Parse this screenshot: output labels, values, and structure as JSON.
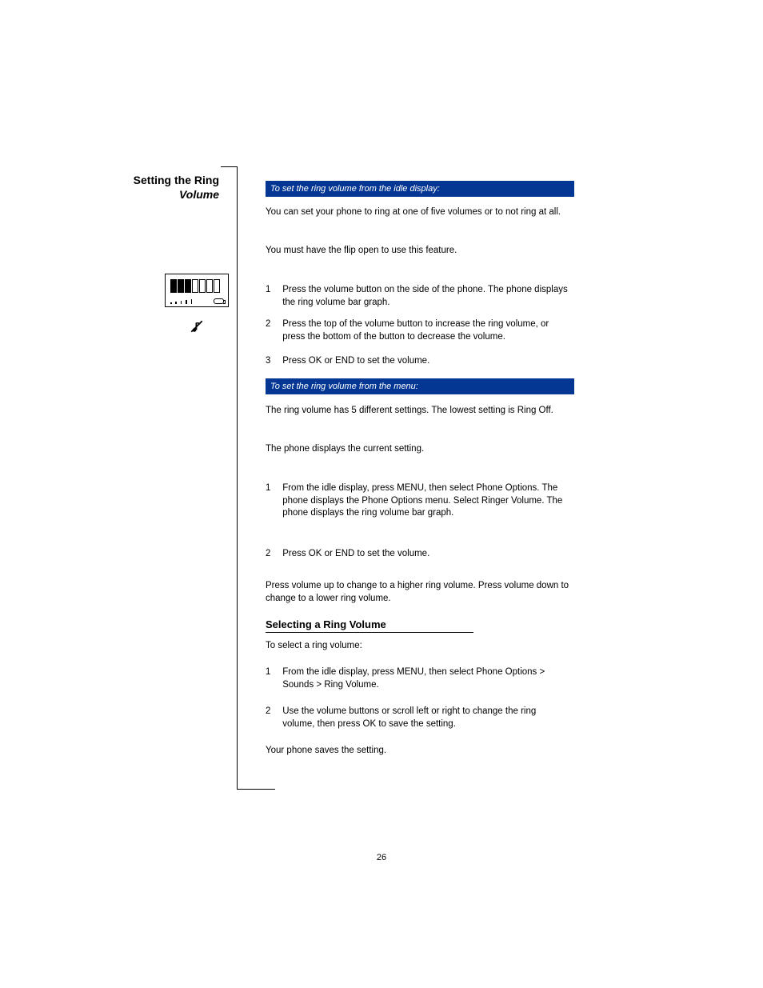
{
  "side_heading": {
    "line1": "Setting the Ring",
    "line2": "Volume"
  },
  "bars": {
    "bar1": "To set the ring volume from the idle display:",
    "bar2": "To set the ring volume from the menu:"
  },
  "paragraphs": {
    "p_intro1": "You can set your phone to ring at one of five volumes or to not ring at all.",
    "p_intro2": "You must have the flip open to use this feature.",
    "p_intro3": "The ring volume has 5 different settings. The lowest setting is Ring Off.",
    "p_intro4": "The phone displays the current setting.",
    "p_sub_intro": "To select a ring volume:",
    "p_tip": "Press volume up to change to a higher ring volume. Press volume down to change to a lower ring volume.",
    "p_final": "Your phone saves the setting."
  },
  "steps": {
    "section1": [
      {
        "n": "1",
        "t": "Press the volume button on the side of the phone. The phone displays the ring volume bar graph."
      },
      {
        "n": "2",
        "t": "Press the top of the volume button to increase the ring volume, or press the bottom of the button to decrease the volume."
      },
      {
        "n": "3",
        "t": "Press OK or END to set the volume."
      }
    ],
    "section2": [
      {
        "n": "1",
        "t": "From the idle display, press MENU, then select Phone Options. The phone displays the Phone Options menu. Select Ringer Volume. The phone displays the ring volume bar graph."
      },
      {
        "n": "2",
        "t": "Press OK or END to set the volume."
      }
    ],
    "section3": [
      {
        "n": "1",
        "t": "From the idle display, press MENU, then select Phone Options > Sounds > Ring Volume."
      },
      {
        "n": "2",
        "t": "Use the volume buttons or scroll left or right to change the ring volume, then press OK to save the setting."
      }
    ]
  },
  "subhead": "Selecting a Ring Volume",
  "lcd": {
    "filled_bars": 3,
    "total_bars": 7
  },
  "page_number": "26"
}
